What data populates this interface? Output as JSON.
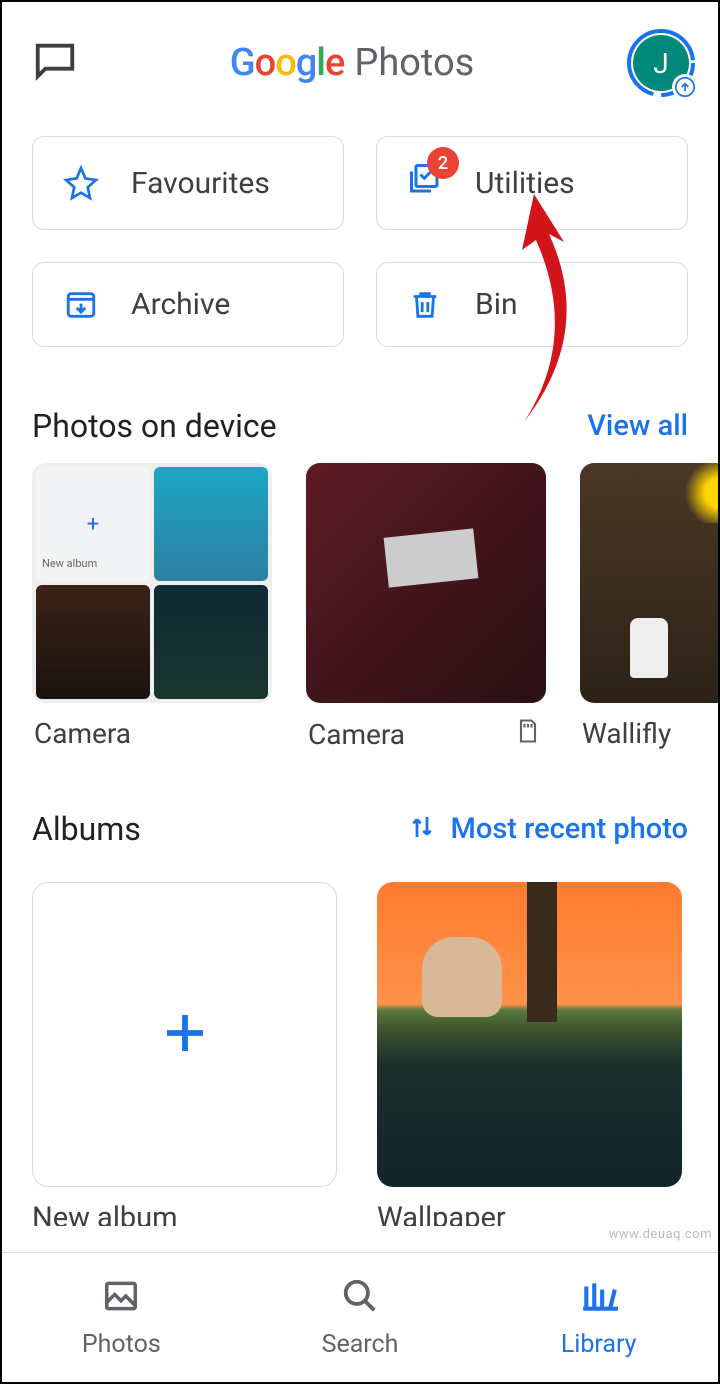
{
  "header": {
    "app_name_google": "Google",
    "app_name_photos": "Photos",
    "avatar_initial": "J"
  },
  "tiles": {
    "favourites": "Favourites",
    "utilities": "Utilities",
    "utilities_badge": "2",
    "archive": "Archive",
    "bin": "Bin"
  },
  "photos_on_device": {
    "title": "Photos on device",
    "view_all": "View all",
    "items": [
      {
        "label": "Camera"
      },
      {
        "label": "Camera"
      },
      {
        "label": "Wallifly"
      }
    ]
  },
  "albums": {
    "title": "Albums",
    "sort_label": "Most recent photo",
    "new_album_label": "New album",
    "items": [
      {
        "label": "Wallpaper"
      }
    ]
  },
  "nav": {
    "photos": "Photos",
    "search": "Search",
    "library": "Library"
  },
  "watermark": "www.deuaq.com"
}
